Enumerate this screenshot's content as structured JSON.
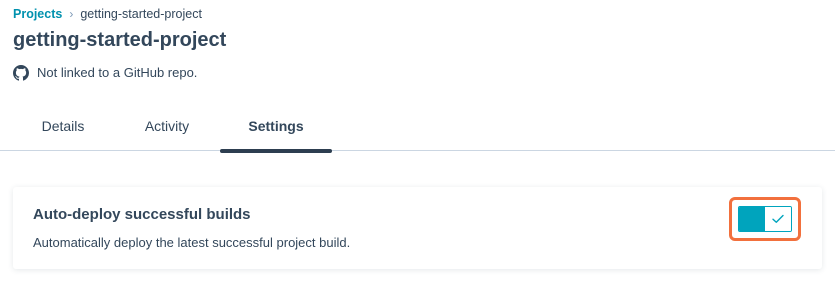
{
  "breadcrumb": {
    "parent": "Projects",
    "separator": "›",
    "current": "getting-started-project"
  },
  "project": {
    "title": "getting-started-project",
    "repo_status": "Not linked to a GitHub repo.",
    "repo_icon": "github-icon"
  },
  "tabs": [
    {
      "label": "Details",
      "active": false
    },
    {
      "label": "Activity",
      "active": false
    },
    {
      "label": "Settings",
      "active": true
    }
  ],
  "settings": {
    "auto_deploy": {
      "title": "Auto-deploy successful builds",
      "description": "Automatically deploy the latest successful project build.",
      "enabled": true,
      "icon": "checkmark-icon"
    }
  },
  "colors": {
    "link": "#0091ae",
    "text": "#33475b",
    "toggle_on": "#00a4bd",
    "highlight": "#f2703d",
    "tab_indicator": "#2d3e50"
  }
}
